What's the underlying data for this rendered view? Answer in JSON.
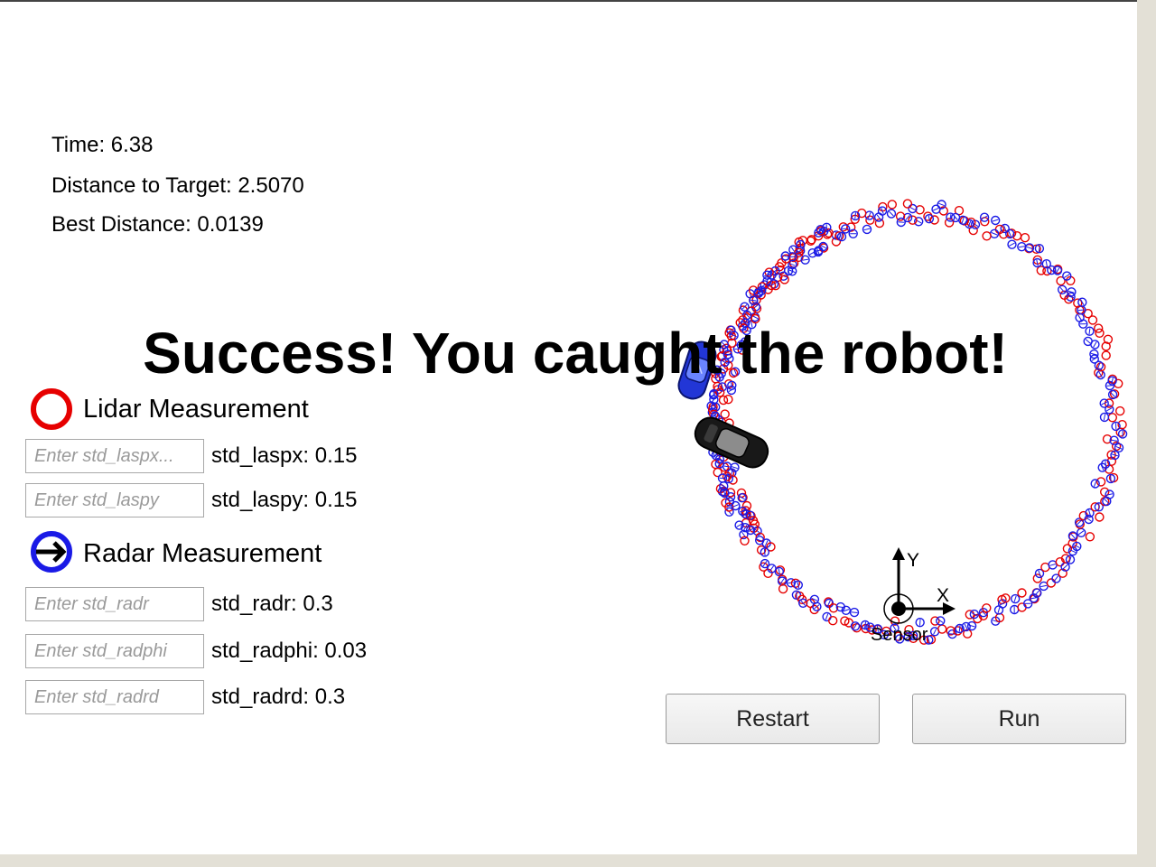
{
  "stats": {
    "time": "Time: 6.38",
    "distance": "Distance to Target: 2.5070",
    "best": "Best Distance: 0.0139"
  },
  "message": "Success! You caught the robot!",
  "legend": {
    "lidar_label": "Lidar Measurement",
    "radar_label": "Radar Measurement",
    "lidar_color": "#e60000",
    "radar_color": "#1a1ae6"
  },
  "params": [
    {
      "placeholder": "Enter std_laspx...",
      "value_text": "std_laspx: 0.15"
    },
    {
      "placeholder": "Enter std_laspy",
      "value_text": "std_laspy: 0.15"
    },
    {
      "placeholder": "Enter std_radr",
      "value_text": "std_radr: 0.3"
    },
    {
      "placeholder": "Enter std_radphi",
      "value_text": "std_radphi: 0.03"
    },
    {
      "placeholder": "Enter std_radrd",
      "value_text": "std_radrd: 0.3"
    }
  ],
  "axes": {
    "x_label": "X",
    "y_label": "Y",
    "sensor_label": "Sensor"
  },
  "buttons": {
    "restart": "Restart",
    "run": "Run"
  },
  "icons": {
    "lidar": "red-ring-icon",
    "radar": "blue-ring-arrow-icon",
    "hunter_car": "black-car-icon",
    "target_car": "blue-car-icon"
  }
}
